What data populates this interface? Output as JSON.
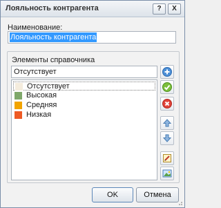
{
  "window": {
    "title": "Лояльность контрагента",
    "help_glyph": "?",
    "close_glyph": "X"
  },
  "name_field": {
    "label": "Наименование:",
    "value": "Лояльность контрагента"
  },
  "elements_group": {
    "title": "Элементы справочника",
    "current_value": "Отсутствует",
    "items": [
      {
        "label": "Отсутствует",
        "color": "#f4ecdd"
      },
      {
        "label": "Высокая",
        "color": "#7fa86b"
      },
      {
        "label": "Средняя",
        "color": "#f2a400"
      },
      {
        "label": "Низкая",
        "color": "#ee5a24"
      }
    ],
    "selected_index": 0,
    "side_buttons": [
      "add-icon",
      "apply-icon",
      "delete-icon",
      "move-up-icon",
      "move-down-icon",
      "edit-icon",
      "image-icon"
    ]
  },
  "buttons": {
    "ok": "OK",
    "cancel": "Отмена"
  }
}
